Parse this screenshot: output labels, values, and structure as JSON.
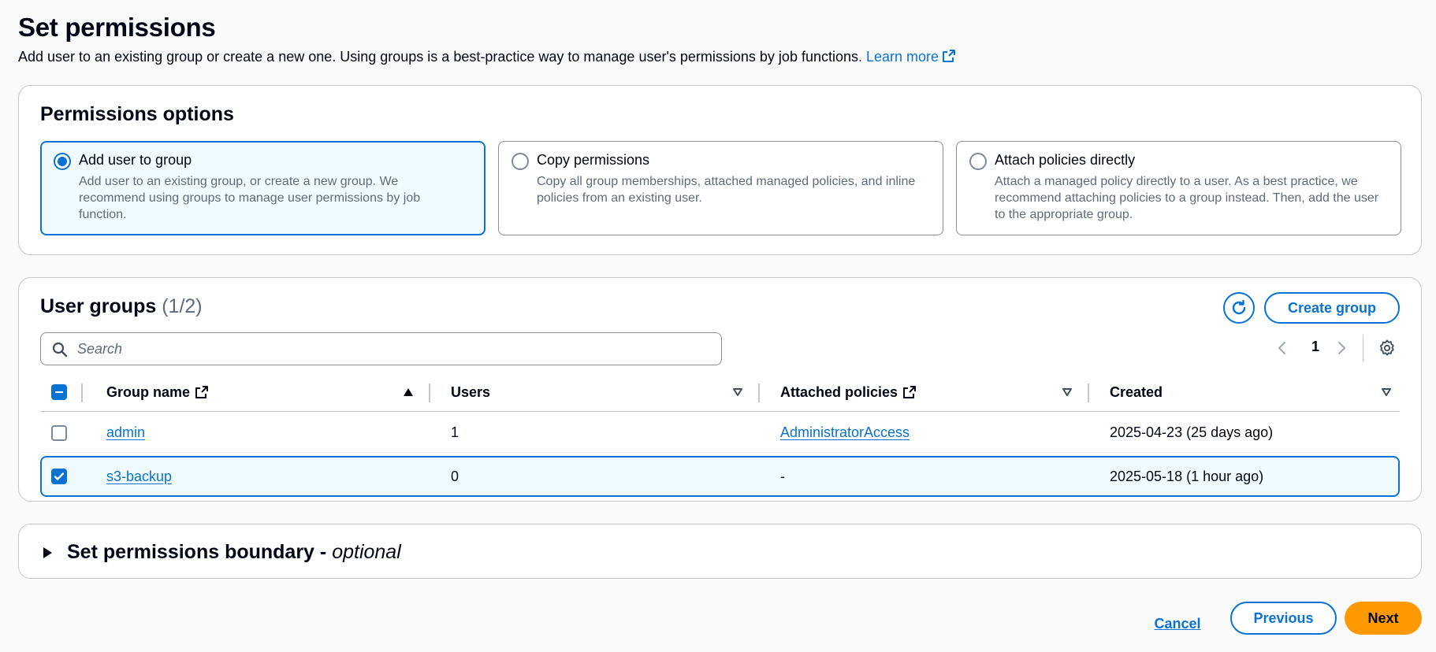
{
  "header": {
    "title": "Set permissions",
    "description": "Add user to an existing group or create a new one. Using groups is a best-practice way to manage user's permissions by job functions.",
    "learn_more": "Learn more"
  },
  "permissions_options": {
    "title": "Permissions options",
    "options": [
      {
        "label": "Add user to group",
        "description": "Add user to an existing group, or create a new group. We recommend using groups to manage user permissions by job function.",
        "selected": true
      },
      {
        "label": "Copy permissions",
        "description": "Copy all group memberships, attached managed policies, and inline policies from an existing user.",
        "selected": false
      },
      {
        "label": "Attach policies directly",
        "description": "Attach a managed policy directly to a user. As a best practice, we recommend attaching policies to a group instead. Then, add the user to the appropriate group.",
        "selected": false
      }
    ]
  },
  "user_groups": {
    "title": "User groups",
    "count": "(1/2)",
    "create_button": "Create group",
    "search_placeholder": "Search",
    "page": "1",
    "columns": [
      "Group name",
      "Users",
      "Attached policies",
      "Created"
    ],
    "rows": [
      {
        "name": "admin",
        "users": "1",
        "policies": "AdministratorAccess",
        "created": "2025-04-23 (25 days ago)",
        "checked": false
      },
      {
        "name": "s3-backup",
        "users": "0",
        "policies": "-",
        "created": "2025-05-18 (1 hour ago)",
        "checked": true
      }
    ]
  },
  "boundary": {
    "title": "Set permissions boundary - ",
    "optional": "optional"
  },
  "footer": {
    "cancel": "Cancel",
    "previous": "Previous",
    "next": "Next"
  },
  "colors": {
    "accent": "#0972d3",
    "primary_button": "#ff9900",
    "selected_bg": "#f0fbff"
  }
}
